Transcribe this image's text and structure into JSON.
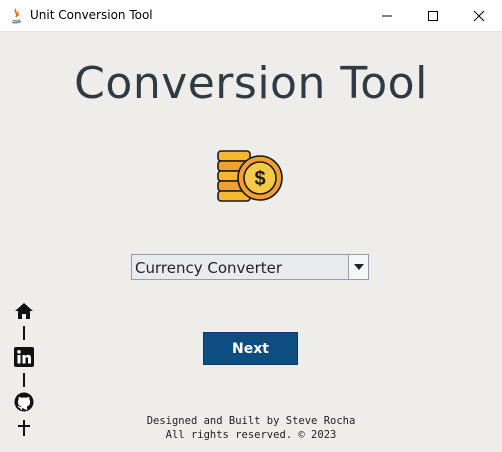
{
  "window": {
    "title": "Unit Conversion Tool",
    "app_icon": "java-icon",
    "controls": [
      "minimize-icon",
      "maximize-icon",
      "close-icon"
    ]
  },
  "main": {
    "title": "Conversion Tool",
    "hero_icon": "coins-dollar-icon",
    "converter_select": {
      "selected": "Currency Converter",
      "arrow_icon": "chevron-down-icon"
    },
    "next_label": "Next"
  },
  "footer": {
    "line1": "Designed and Built by Steve Rocha",
    "line2": "All rights reserved. © 2023"
  },
  "sidebar": {
    "icons": [
      "home-icon",
      "linkedin-icon",
      "github-icon",
      "pin-icon"
    ]
  },
  "colors": {
    "background": "#eeede9",
    "title_text": "#2e3a44",
    "button_bg": "#0e4d80",
    "coin_gold": "#f7b731",
    "coin_orange": "#f59e32"
  }
}
